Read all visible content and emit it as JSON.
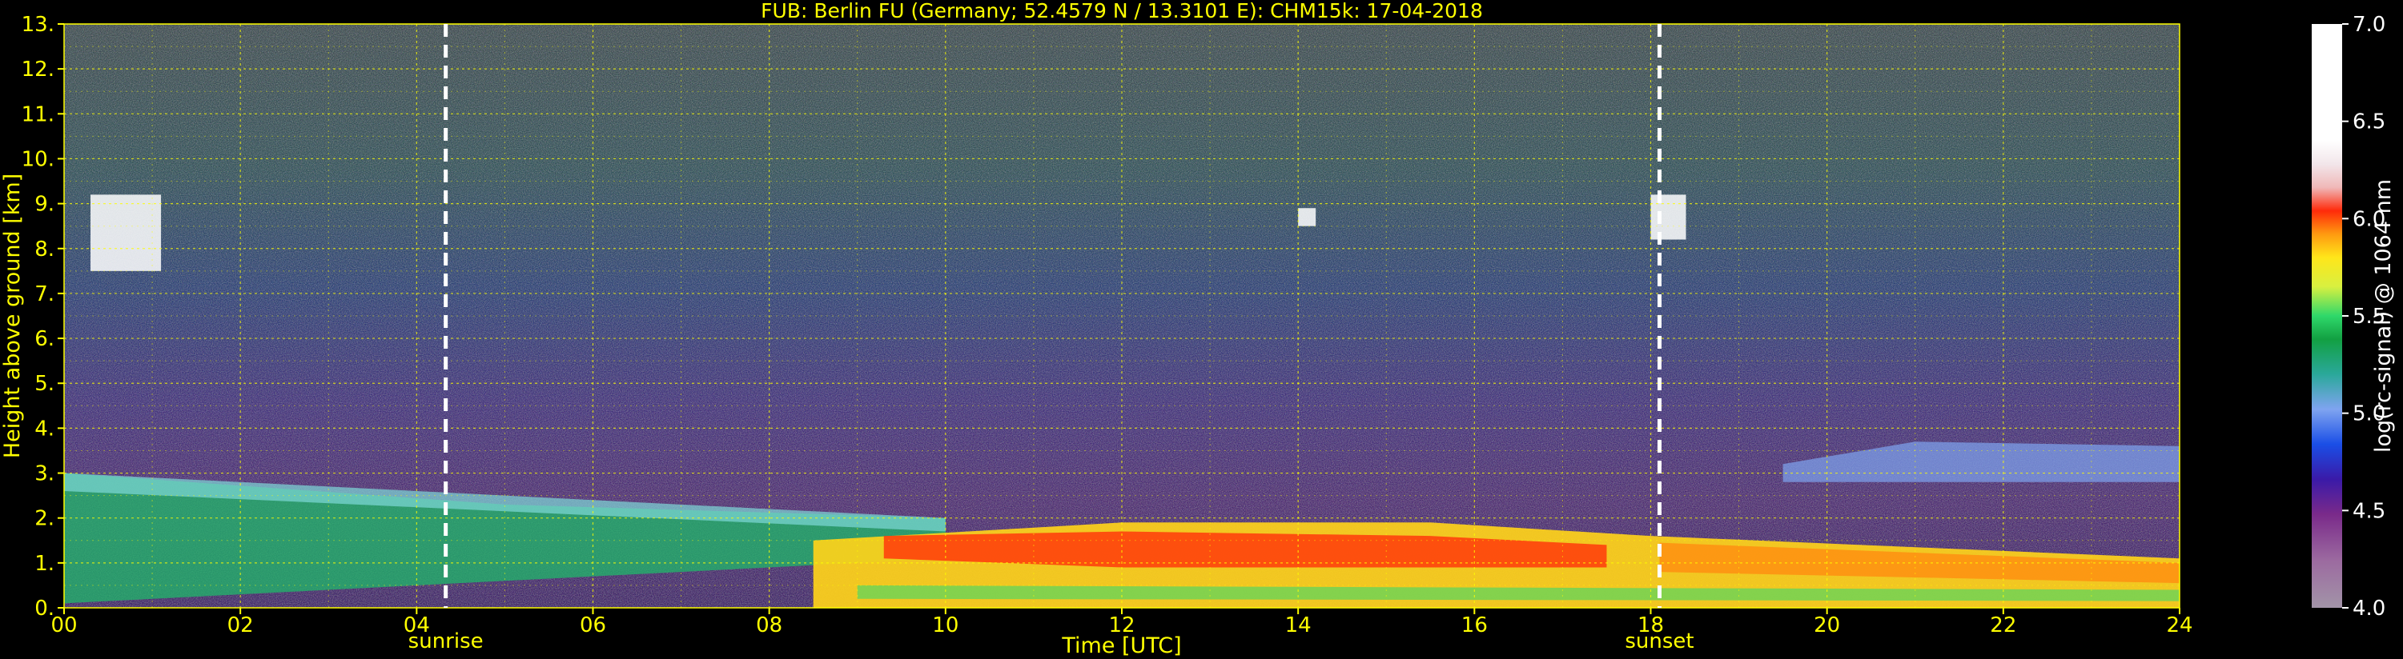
{
  "chart_data": {
    "type": "heatmap",
    "title": "FUB: Berlin FU (Germany; 52.4579 N / 13.3101 E):    CHM15k: 17-04-2018",
    "xlabel": "Time [UTC]",
    "ylabel": "Height above ground [km]",
    "xlim": [
      0,
      24
    ],
    "ylim": [
      0,
      13
    ],
    "x_ticks": [
      0,
      2,
      4,
      6,
      8,
      10,
      12,
      14,
      16,
      18,
      20,
      22,
      24
    ],
    "x_tick_labels": [
      "00",
      "02",
      "04",
      "06",
      "08",
      "10",
      "12",
      "14",
      "16",
      "18",
      "20",
      "22",
      "24"
    ],
    "y_ticks": [
      0,
      1,
      2,
      3,
      4,
      5,
      6,
      7,
      8,
      9,
      10,
      11,
      12,
      13
    ],
    "y_tick_labels": [
      "0.",
      "1.",
      "2.",
      "3.",
      "4.",
      "5.",
      "6.",
      "7.",
      "8.",
      "9.",
      "10.",
      "11.",
      "12.",
      "13."
    ],
    "grid": true,
    "markers": [
      {
        "label": "sunrise",
        "x": 4.33
      },
      {
        "label": "sunset",
        "x": 18.1
      }
    ],
    "colorbar": {
      "label": "log(rc-signal) @ 1064 nm",
      "range": [
        4.0,
        7.0
      ],
      "ticks": [
        4.0,
        4.5,
        5.0,
        5.5,
        6.0,
        6.5,
        7.0
      ],
      "tick_labels": [
        "4.0",
        "4.5",
        "5.0",
        "5.5",
        "6.0",
        "6.5",
        "7.0"
      ]
    },
    "features": [
      {
        "name": "residual layer",
        "t0": 0,
        "t1": 10,
        "bottom_km": 1.8,
        "top_km_start": 3.0,
        "top_km_end": 2.0
      },
      {
        "name": "boundary layer",
        "t0": 8.5,
        "t1": 24,
        "top_km_start": 1.5,
        "top_km_mid": 1.9,
        "top_km_end": 1.1
      },
      {
        "name": "cirrus",
        "t0": 0.3,
        "t1": 1.1,
        "bottom_km": 7.5,
        "top_km": 9.2
      },
      {
        "name": "cirrus",
        "t0": 14.0,
        "t1": 14.2,
        "bottom_km": 8.5,
        "top_km": 8.9
      },
      {
        "name": "cirrus",
        "t0": 18.0,
        "t1": 18.4,
        "bottom_km": 8.2,
        "top_km": 9.2
      },
      {
        "name": "aerosol layer",
        "t0": 19.5,
        "t1": 24,
        "bottom_km": 2.8,
        "top_km": 3.7
      }
    ]
  }
}
